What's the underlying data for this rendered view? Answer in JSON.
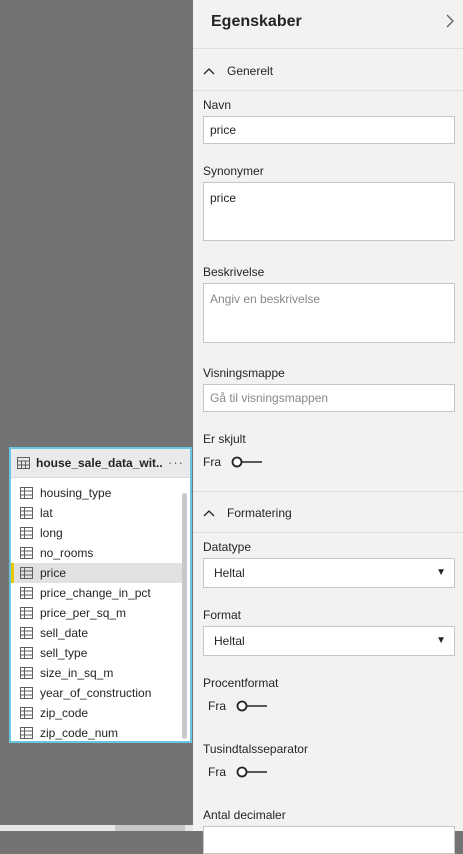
{
  "table_card": {
    "title": "house_sale_data_wit...",
    "more_label": "···",
    "fields": [
      {
        "label": "housing_type",
        "selected": false
      },
      {
        "label": "lat",
        "selected": false
      },
      {
        "label": "long",
        "selected": false
      },
      {
        "label": "no_rooms",
        "selected": false
      },
      {
        "label": "price",
        "selected": true
      },
      {
        "label": "price_change_in_pct",
        "selected": false
      },
      {
        "label": "price_per_sq_m",
        "selected": false
      },
      {
        "label": "sell_date",
        "selected": false
      },
      {
        "label": "sell_type",
        "selected": false
      },
      {
        "label": "size_in_sq_m",
        "selected": false
      },
      {
        "label": "year_of_construction",
        "selected": false
      },
      {
        "label": "zip_code",
        "selected": false
      },
      {
        "label": "zip_code_num",
        "selected": false
      }
    ]
  },
  "pane": {
    "title": "Egenskaber",
    "general": {
      "header": "Generelt",
      "name_label": "Navn",
      "name_value": "price",
      "synonyms_label": "Synonymer",
      "synonyms_value": "price",
      "description_label": "Beskrivelse",
      "description_placeholder": "Angiv en beskrivelse",
      "display_folder_label": "Visningsmappe",
      "display_folder_placeholder": "Gå til visningsmappen",
      "hidden_label": "Er skjult",
      "hidden_state": "Fra"
    },
    "formatting": {
      "header": "Formatering",
      "datatype_label": "Datatype",
      "datatype_value": "Heltal",
      "format_label": "Format",
      "format_value": "Heltal",
      "percent_label": "Procentformat",
      "percent_state": "Fra",
      "thousands_label": "Tusindtalsseparator",
      "thousands_state": "Fra",
      "decimals_label": "Antal decimaler"
    }
  },
  "colors": {
    "card_border": "#68c6e2",
    "selected_marker": "#e8c800",
    "canvas": "#737373",
    "pane_bg": "#f3f2f1"
  }
}
